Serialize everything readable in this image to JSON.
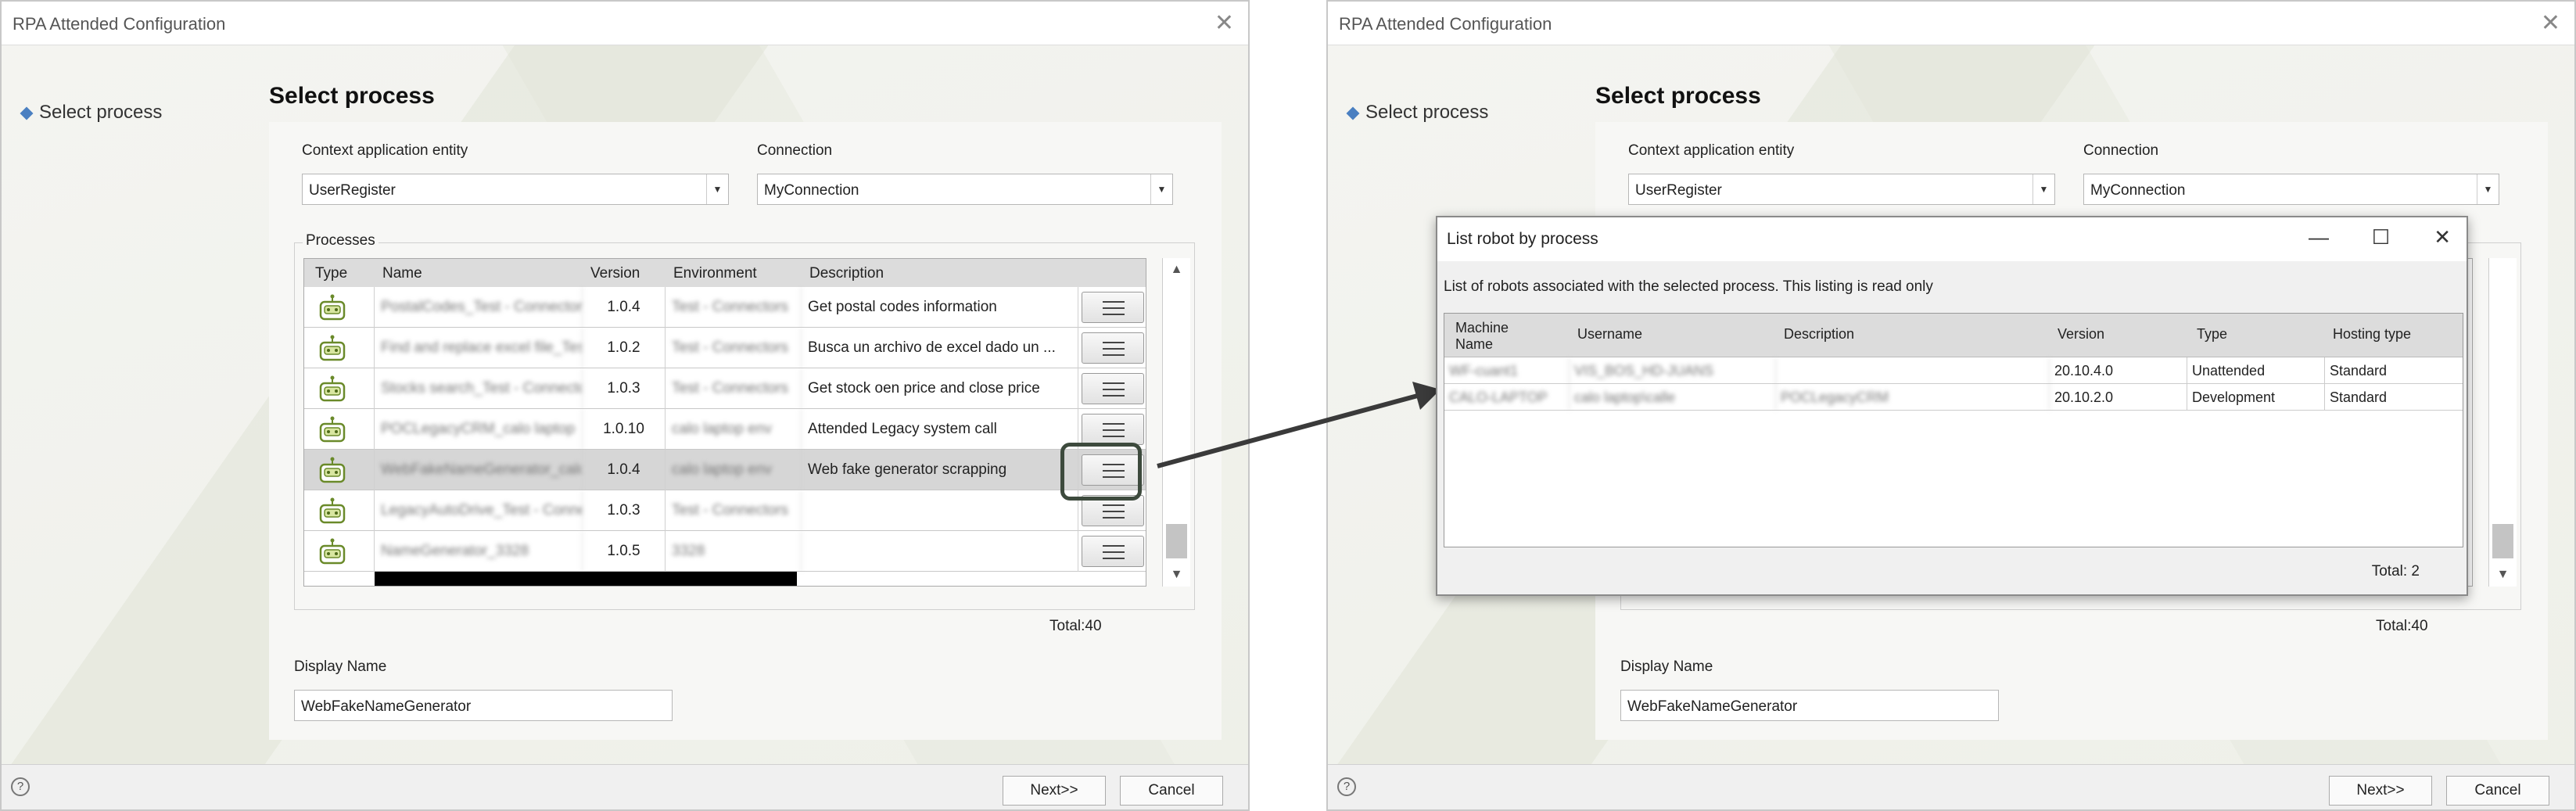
{
  "window_title": "RPA Attended Configuration",
  "step_label": "Select process",
  "heading": "Select process",
  "context_label": "Context application entity",
  "context_value": "UserRegister",
  "connection_label": "Connection",
  "connection_value": "MyConnection",
  "processes_label": "Processes",
  "columns": {
    "type": "Type",
    "name": "Name",
    "version": "Version",
    "environment": "Environment",
    "description": "Description"
  },
  "rows": [
    {
      "name": "PostalCodes_Test - Connectors",
      "version": "1.0.4",
      "environment": "Test - Connectors",
      "description": "Get postal codes information"
    },
    {
      "name": "Find and replace excel file_Test - Connectors",
      "version": "1.0.2",
      "environment": "Test - Connectors",
      "description": "Busca un archivo de excel dado un ..."
    },
    {
      "name": "Stocks search_Test - Connectors",
      "version": "1.0.3",
      "environment": "Test - Connectors",
      "description": "Get stock oen price and close price"
    },
    {
      "name": "POCLegacyCRM_calo laptop",
      "version": "1.0.10",
      "environment": "calo laptop env",
      "description": "Attended Legacy system call"
    },
    {
      "name": "WebFakeNameGenerator_calo",
      "version": "1.0.4",
      "environment": "calo laptop env",
      "description": "Web fake generator scrapping"
    },
    {
      "name": "LegacyAutoDrive_Test - Connectors",
      "version": "1.0.3",
      "environment": "Test - Connectors",
      "description": ""
    },
    {
      "name": "NameGenerator_3328",
      "version": "1.0.5",
      "environment": "3328",
      "description": ""
    }
  ],
  "total_processes": "Total:40",
  "display_name_label": "Display Name",
  "display_name_value": "WebFakeNameGenerator",
  "next_button": "Next>>",
  "cancel_button": "Cancel",
  "help_glyph": "?",
  "close_glyph": "✕",
  "dialog": {
    "title": "List robot by process",
    "minimize_glyph": "—",
    "maximize_glyph": "☐",
    "close_glyph": "✕",
    "subtitle": "List of robots associated with the selected process. This listing is read only",
    "columns": {
      "machine_name": "Machine Name",
      "username": "Username",
      "description": "Description",
      "version": "Version",
      "type": "Type",
      "hosting_type": "Hosting type"
    },
    "rows": [
      {
        "machine_name": "WF-cuant1",
        "username": "VIS_BOS_HD-JUANS",
        "description": "",
        "version": "20.10.4.0",
        "type": "Unattended",
        "hosting_type": "Standard"
      },
      {
        "machine_name": "CALO-LAPTOP",
        "username": "calo laptop\\calle",
        "description": "POCLegacyCRM",
        "version": "20.10.2.0",
        "type": "Development",
        "hosting_type": "Standard"
      }
    ],
    "total": "Total: 2"
  },
  "colors": {
    "accent": "#4a7fc1",
    "highlight": "#3d4a3d",
    "arrow": "#3a3a3a"
  }
}
